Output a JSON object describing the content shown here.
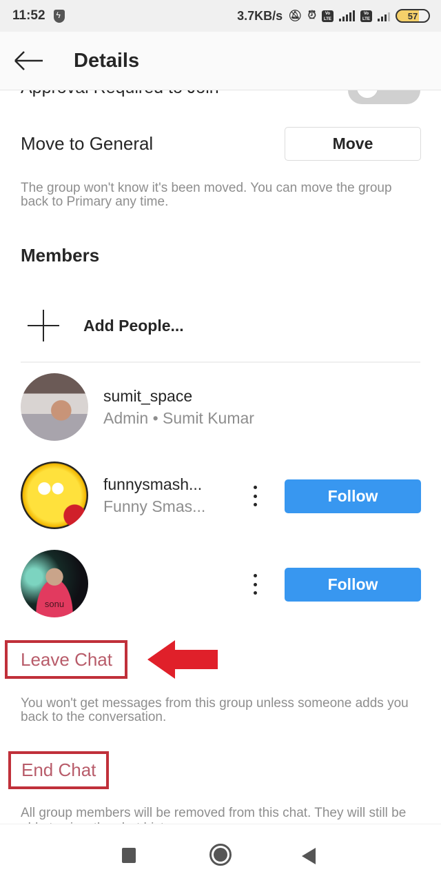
{
  "status_bar": {
    "time": "11:52",
    "network_speed": "3.7KB/s",
    "network_type": "4G",
    "volte_label": "Vo LTE",
    "battery_level": "57"
  },
  "header": {
    "title": "Details"
  },
  "settings": {
    "approval_label": "Approval Required to Join",
    "approval_enabled": false,
    "move_label": "Move to General",
    "move_button": "Move",
    "move_description": "The group won't know it's been moved. You can move the group back to Primary any time."
  },
  "members": {
    "title": "Members",
    "add_people_label": "Add People...",
    "list": [
      {
        "username": "sumit_space",
        "subtitle": "Admin • Sumit Kumar",
        "show_follow": false
      },
      {
        "username": "funnysmash...",
        "subtitle": "Funny Smas...",
        "show_follow": true,
        "follow_label": "Follow"
      },
      {
        "username": "",
        "subtitle": "",
        "avatar_text": "sonu",
        "show_follow": true,
        "follow_label": "Follow"
      }
    ]
  },
  "actions": {
    "leave_label": "Leave Chat",
    "leave_description": "You won't get messages from this group unless someone adds you back to the conversation.",
    "end_label": "End Chat",
    "end_description": "All group members will be removed from this chat. They will still be able to view the chat history."
  },
  "colors": {
    "follow_blue": "#3897f0",
    "danger_text": "#b85c6a",
    "annotation_red": "#e0202a",
    "annotation_box": "#c0303a"
  }
}
